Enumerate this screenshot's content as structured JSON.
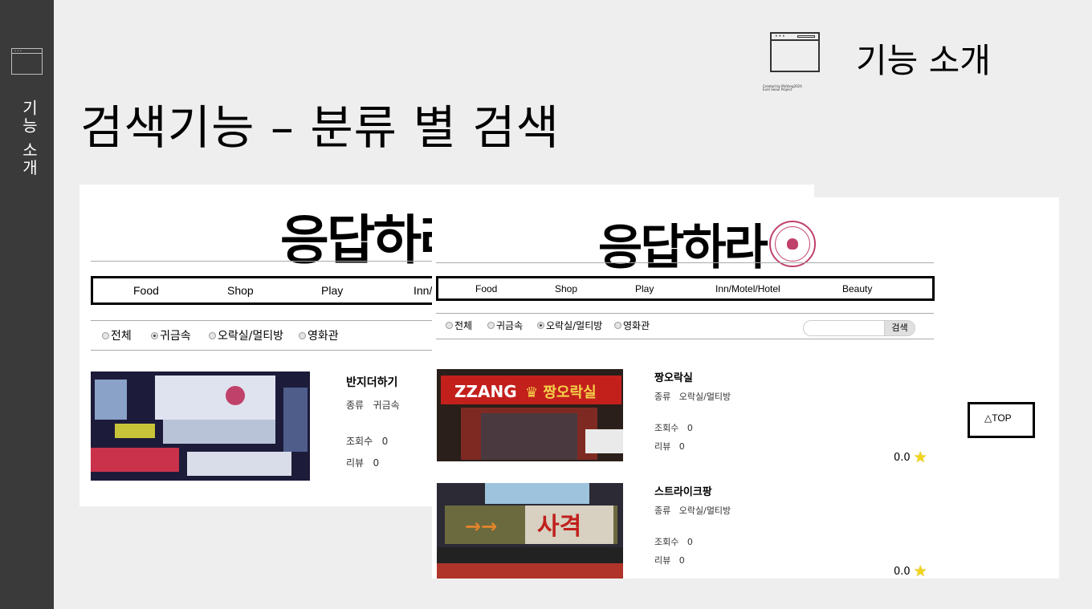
{
  "sidebar": {
    "label": "기능 소개",
    "icon": "window-icon"
  },
  "header": {
    "title": "기능 소개",
    "icon": "window-icon",
    "credit_line1": "Created by MoYang2024",
    "credit_line2": "Eum Seoul Project"
  },
  "page": {
    "title": "검색기능 – 분류 별 검색"
  },
  "brand": {
    "logo_text": "응답하라",
    "accent": "#c0416a"
  },
  "panel1": {
    "nav": [
      "Food",
      "Shop",
      "Play",
      "Inn/"
    ],
    "filters": [
      {
        "label": "전체",
        "checked": false
      },
      {
        "label": "귀금속",
        "checked": true
      },
      {
        "label": "오락실/멀티방",
        "checked": false
      },
      {
        "label": "영화관",
        "checked": false
      }
    ],
    "item": {
      "name": "반지더하기",
      "category_label": "종류",
      "category": "귀금속",
      "views_label": "조회수",
      "views": "0",
      "reviews_label": "리뷰",
      "reviews": "0"
    }
  },
  "panel2": {
    "nav": [
      "Food",
      "Shop",
      "Play",
      "Inn/Motel/Hotel",
      "Beauty"
    ],
    "filters": [
      {
        "label": "전체",
        "checked": false
      },
      {
        "label": "귀금속",
        "checked": false
      },
      {
        "label": "오락실/멀티방",
        "checked": true
      },
      {
        "label": "영화관",
        "checked": false
      }
    ],
    "search": {
      "button": "검색",
      "placeholder": ""
    },
    "items": [
      {
        "name": "짱오락실",
        "category_label": "종류",
        "category": "오락실/멀티방",
        "views_label": "조회수",
        "views": "0",
        "reviews_label": "리뷰",
        "reviews": "0",
        "rating": "0.0"
      },
      {
        "name": "스트라이크팡",
        "category_label": "종류",
        "category": "오락실/멀티방",
        "views_label": "조회수",
        "views": "0",
        "reviews_label": "리뷰",
        "reviews": "0",
        "rating": "0.0"
      }
    ],
    "top_button": "△TOP"
  }
}
